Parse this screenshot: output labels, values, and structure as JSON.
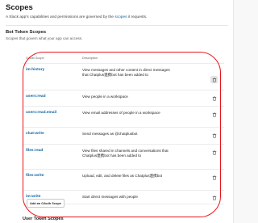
{
  "header": {
    "title": "Scopes",
    "intro_prefix": "A Slack app's capabilities and permissions are governed by the",
    "intro_link": "scopes",
    "intro_suffix": "it requests."
  },
  "bot_section": {
    "title": "Bot Token Scopes",
    "subtitle": "Scopes that govern what your app can access."
  },
  "table": {
    "col_scope": "OAuth Scope",
    "col_description": "Description",
    "rows": [
      {
        "scope": "im:history",
        "description": "View messages and other content in direct messages that Chatplus連携bot has been added to"
      },
      {
        "scope": "users:read",
        "description": "View people in a workspace"
      },
      {
        "scope": "users:read.email",
        "description": "View email addresses of people in a workspace"
      },
      {
        "scope": "chat:write",
        "description": "Send messages as @chatplusbot"
      },
      {
        "scope": "files:read",
        "description": "View files shared in channels and conversations that Chatplus連携bot has been added to"
      },
      {
        "scope": "files:write",
        "description": "Upload, edit, and delete files as Chatplus連携bot"
      },
      {
        "scope": "im:write",
        "description": "Start direct messages with people"
      }
    ]
  },
  "add_button_label": "Add an OAuth Scope",
  "next_section_title": "User Token Scopes",
  "colors": {
    "link": "#1264a3",
    "annotation": "#e8161b"
  }
}
